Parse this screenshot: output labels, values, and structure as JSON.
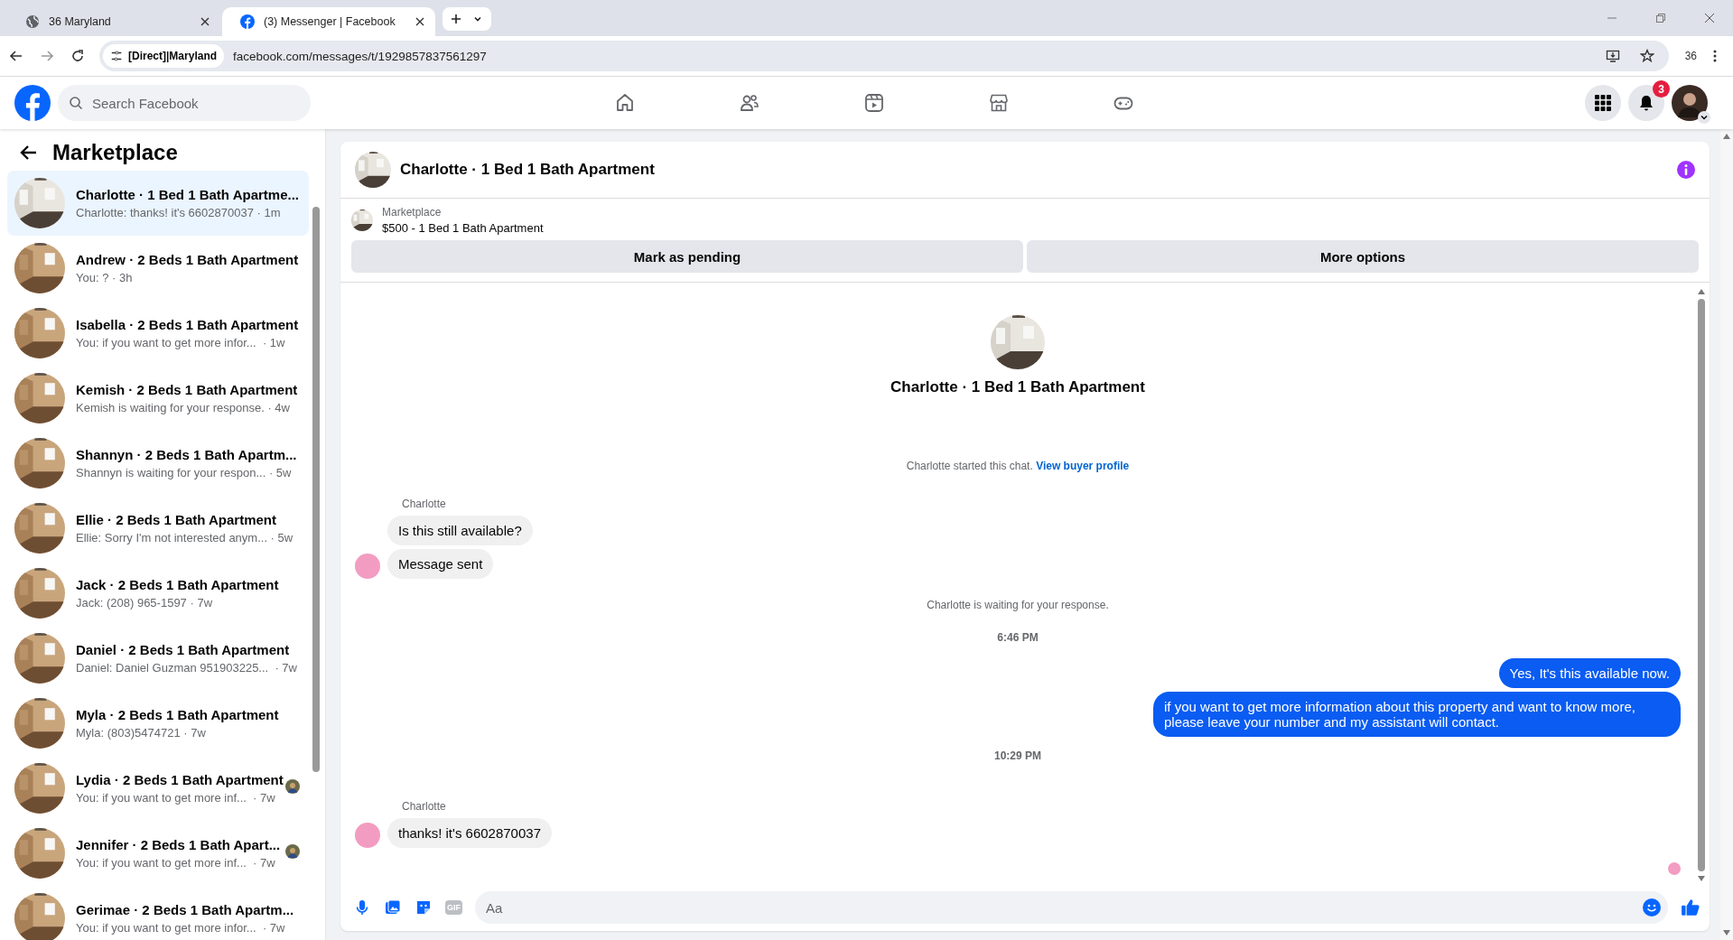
{
  "browser": {
    "tabs": [
      {
        "title": "36 Maryland",
        "selected": false,
        "kind": "globe"
      },
      {
        "title": "(3) Messenger | Facebook",
        "selected": true,
        "kind": "facebook"
      }
    ],
    "address": {
      "badge": "[Direct]|Maryland",
      "url": "facebook.com/messages/t/1929857837561297"
    },
    "profile_label": "36"
  },
  "header": {
    "search": {
      "placeholder": "Search Facebook"
    },
    "notification_count": "3"
  },
  "sidebar": {
    "title": "Marketplace",
    "conversations": [
      {
        "title": "Charlotte · 1 Bed 1 Bath Apartme...",
        "preview": "Charlotte: thanks! it's 6602870037 · 1m",
        "selected": true,
        "seen_avatar": false
      },
      {
        "title": "Andrew · 2 Beds 1 Bath Apartment",
        "preview": "You: ? · 3h",
        "selected": false,
        "seen_avatar": false
      },
      {
        "title": "Isabella · 2 Beds 1 Bath Apartment",
        "preview": "You: if you want to get more infor...  · 1w",
        "selected": false,
        "seen_avatar": false
      },
      {
        "title": "Kemish · 2 Beds 1 Bath Apartment",
        "preview": "Kemish is waiting for your response. · 4w",
        "selected": false,
        "seen_avatar": false
      },
      {
        "title": "Shannyn · 2 Beds 1 Bath Apartm...",
        "preview": "Shannyn is waiting for your respon... · 5w",
        "selected": false,
        "seen_avatar": false
      },
      {
        "title": "Ellie · 2 Beds 1 Bath Apartment",
        "preview": "Ellie: Sorry I'm not interested anym... · 5w",
        "selected": false,
        "seen_avatar": false
      },
      {
        "title": "Jack · 2 Beds 1 Bath Apartment",
        "preview": "Jack: (208) 965-1597 · 7w",
        "selected": false,
        "seen_avatar": false
      },
      {
        "title": "Daniel · 2 Beds 1 Bath Apartment",
        "preview": "Daniel: Daniel Guzman 951903225...  · 7w",
        "selected": false,
        "seen_avatar": false
      },
      {
        "title": "Myla · 2 Beds 1 Bath Apartment",
        "preview": "Myla: (803)5474721 · 7w",
        "selected": false,
        "seen_avatar": false
      },
      {
        "title": "Lydia · 2 Beds 1 Bath Apartment",
        "preview": "You: if you want to get more inf...  · 7w",
        "selected": false,
        "seen_avatar": true
      },
      {
        "title": "Jennifer · 2 Beds 1 Bath Apart...",
        "preview": "You: if you want to get more inf...  · 7w",
        "selected": false,
        "seen_avatar": true
      },
      {
        "title": "Gerimae · 2 Beds 1 Bath Apartm...",
        "preview": "You: if you want to get more infor...  · 7w",
        "selected": false,
        "seen_avatar": false
      }
    ]
  },
  "chat": {
    "title": "Charlotte · 1 Bed 1 Bath Apartment",
    "listing": {
      "label": "Marketplace",
      "text": "$500 - 1 Bed 1 Bath Apartment"
    },
    "actions": [
      "Mark as pending",
      "More options"
    ],
    "intro": {
      "title": "Charlotte · 1 Bed 1 Bath Apartment",
      "text": "Charlotte started this chat.",
      "link": "View buyer profile"
    },
    "messages": [
      {
        "kind": "sender",
        "text": "Charlotte"
      },
      {
        "kind": "incoming",
        "text": "Is this still available?",
        "avatar": false
      },
      {
        "kind": "incoming",
        "text": "Message sent",
        "avatar": true
      },
      {
        "kind": "notice",
        "text": "Charlotte is waiting for your response."
      },
      {
        "kind": "time",
        "text": "6:46 PM"
      },
      {
        "kind": "outgoing",
        "text": "Yes, It's this available now."
      },
      {
        "kind": "outgoing",
        "text": "if you want to get more information about this property and want to know more, please leave your number and my assistant will contact."
      },
      {
        "kind": "time",
        "text": "10:29 PM"
      },
      {
        "kind": "sender",
        "text": "Charlotte"
      },
      {
        "kind": "incoming",
        "text": "thanks! it's 6602870037",
        "avatar": true
      }
    ],
    "composer": {
      "placeholder": "Aa",
      "gif_label": "GIF"
    }
  }
}
